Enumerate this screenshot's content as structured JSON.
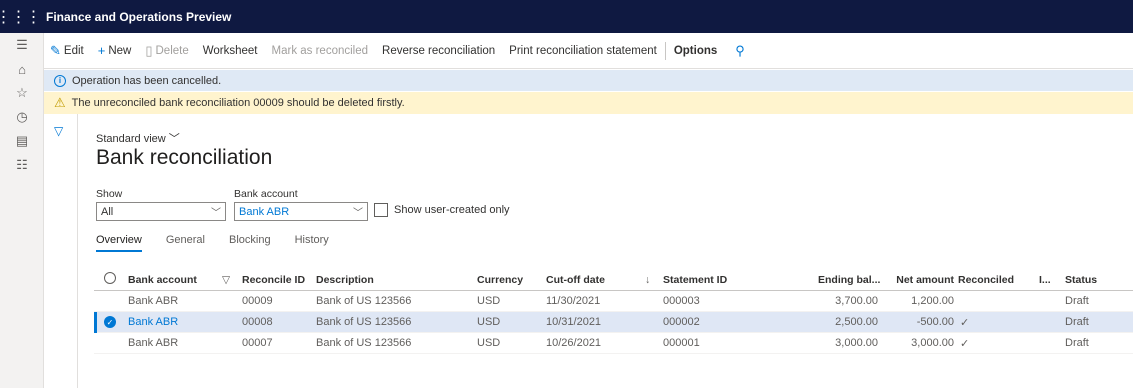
{
  "app": {
    "title": "Finance and Operations Preview"
  },
  "rail": {
    "icons": [
      "hamburger-icon",
      "home-icon",
      "star-icon",
      "recent-icon",
      "workspace-icon",
      "modules-icon"
    ]
  },
  "actions": {
    "edit": "Edit",
    "new": "New",
    "delete": "Delete",
    "worksheet": "Worksheet",
    "mark_reconciled": "Mark as reconciled",
    "reverse": "Reverse reconciliation",
    "print": "Print reconciliation statement",
    "options": "Options"
  },
  "messages": {
    "info": "Operation has been cancelled.",
    "warning": "The unreconciled bank reconciliation 00009 should be deleted firstly."
  },
  "view": {
    "label": "Standard view",
    "title": "Bank reconciliation"
  },
  "filters": {
    "show_label": "Show",
    "show_value": "All",
    "account_label": "Bank account",
    "account_value": "Bank ABR",
    "user_created_label": "Show user-created only"
  },
  "tabs": [
    "Overview",
    "General",
    "Blocking",
    "History"
  ],
  "grid": {
    "headers": {
      "bank_account": "Bank account",
      "reconcile_id": "Reconcile ID",
      "description": "Description",
      "currency": "Currency",
      "cutoff": "Cut-off date",
      "statement_id": "Statement ID",
      "ending_balance": "Ending bal...",
      "net_amount": "Net amount",
      "reconciled": "Reconciled",
      "i": "I...",
      "status": "Status"
    },
    "rows": [
      {
        "bank_account": "Bank ABR",
        "reconcile_id": "00009",
        "description": "Bank of US 123566",
        "currency": "USD",
        "cutoff": "11/30/2021",
        "statement_id": "000003",
        "ending_balance": "3,700.00",
        "net_amount": "1,200.00",
        "reconciled": "",
        "status": "Draft"
      },
      {
        "bank_account": "Bank ABR",
        "reconcile_id": "00008",
        "description": "Bank of US 123566",
        "currency": "USD",
        "cutoff": "10/31/2021",
        "statement_id": "000002",
        "ending_balance": "2,500.00",
        "net_amount": "-500.00",
        "reconciled": "✓",
        "status": "Draft"
      },
      {
        "bank_account": "Bank ABR",
        "reconcile_id": "00007",
        "description": "Bank of US 123566",
        "currency": "USD",
        "cutoff": "10/26/2021",
        "statement_id": "000001",
        "ending_balance": "3,000.00",
        "net_amount": "3,000.00",
        "reconciled": "✓",
        "status": "Draft"
      }
    ]
  }
}
